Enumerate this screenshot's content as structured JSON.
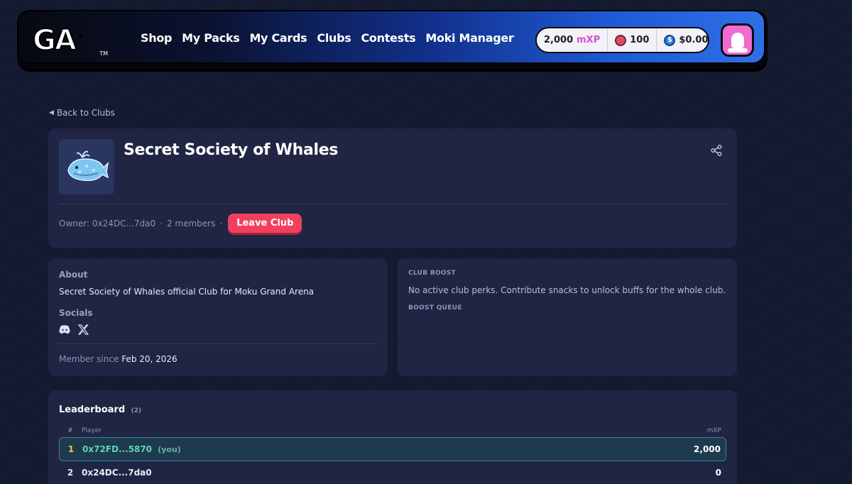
{
  "nav": {
    "logo_text": "GA",
    "logo_tm": "TM",
    "links": [
      "Shop",
      "My Packs",
      "My Cards",
      "Clubs",
      "Contests",
      "Moki Manager"
    ],
    "stats": {
      "mxp_value": "2,000",
      "mxp_unit": "mXP",
      "snacks": "100",
      "balance": "$0.00"
    }
  },
  "back_link": "Back to Clubs",
  "club": {
    "name": "Secret Society of Whales",
    "owner": "Owner: 0x24DC...7da0",
    "members": "2 members",
    "leave_label": "Leave Club"
  },
  "about": {
    "heading": "About",
    "description": "Secret Society of Whales official Club for Moku Grand Arena",
    "socials_heading": "Socials",
    "member_since_label": "Member since",
    "member_since_date": "Feb 20, 2026"
  },
  "boost": {
    "heading": "CLUB BOOST",
    "message": "No active club perks. Contribute snacks to unlock buffs for the whole club.",
    "queue_heading": "BOOST QUEUE"
  },
  "leaderboard": {
    "title": "Leaderboard",
    "count": "(2)",
    "columns": {
      "rank": "#",
      "player": "Player",
      "mxp": "mXP"
    },
    "rows": [
      {
        "rank": "1",
        "player": "0x72FD...5870",
        "you": "(you)",
        "mxp": "2,000"
      },
      {
        "rank": "2",
        "player": "0x24DC...7da0",
        "you": "",
        "mxp": "0"
      }
    ]
  },
  "colors": {
    "accent_pink": "#d94bd8",
    "leave_red": "#f0405e",
    "rank_gold": "#f3c33b",
    "you_green": "#5fd3b5"
  }
}
